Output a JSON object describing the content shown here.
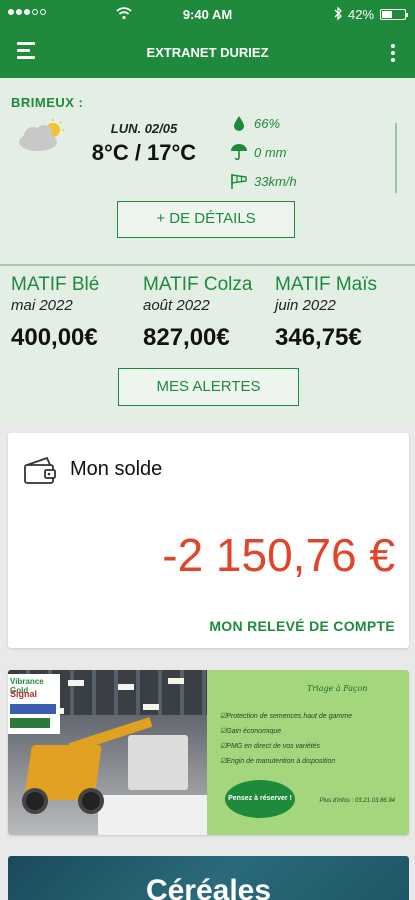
{
  "status_bar": {
    "time": "9:40 AM",
    "battery": "42%",
    "battery_level": 0.42
  },
  "app_bar": {
    "title": "EXTRANET DURIEZ"
  },
  "weather": {
    "city": "BRIMEUX :",
    "date": "LUN. 02/05",
    "temperature": "8°C / 17°C",
    "humidity": "66%",
    "rain": "0 mm",
    "wind": "33km/h",
    "details_button": "+ DE DÉTAILS"
  },
  "matif": [
    {
      "name": "MATIF Blé",
      "date": "mai 2022",
      "price": "400,00€"
    },
    {
      "name": "MATIF Colza",
      "date": "août 2022",
      "price": "827,00€"
    },
    {
      "name": "MATIF Maïs",
      "date": "juin 2022",
      "price": "346,75€"
    }
  ],
  "alerts_button": "MES ALERTES",
  "balance": {
    "label": "Mon solde",
    "amount": "-2 150,76 €",
    "statement_link": "MON RELEVÉ DE COMPTE"
  },
  "banner": {
    "logos": [
      "Vibrance Gold",
      "Signal"
    ],
    "title": "Triage à Façon",
    "items": [
      "☑Protection de semences haut de gamme",
      "☑Gain économique",
      "☑PMG en direct de vos variétés",
      "☑Engin de manutention à disposition"
    ],
    "seal": "Pensez à réserver !",
    "contact": "Plus d'infos : 03.21.03.86.94"
  },
  "category_card": {
    "title": "Céréales"
  },
  "colors": {
    "brand_green": "#1f8a3c",
    "negative_red": "#e0442a",
    "card_bg": "#e3eee5"
  },
  "icons": {
    "menu": "hamburger-icon",
    "more": "more-vertical-icon",
    "weather": "cloud-sun-icon",
    "humidity": "droplet-icon",
    "rain": "umbrella-icon",
    "wind": "windsock-icon",
    "wallet": "wallet-icon"
  }
}
